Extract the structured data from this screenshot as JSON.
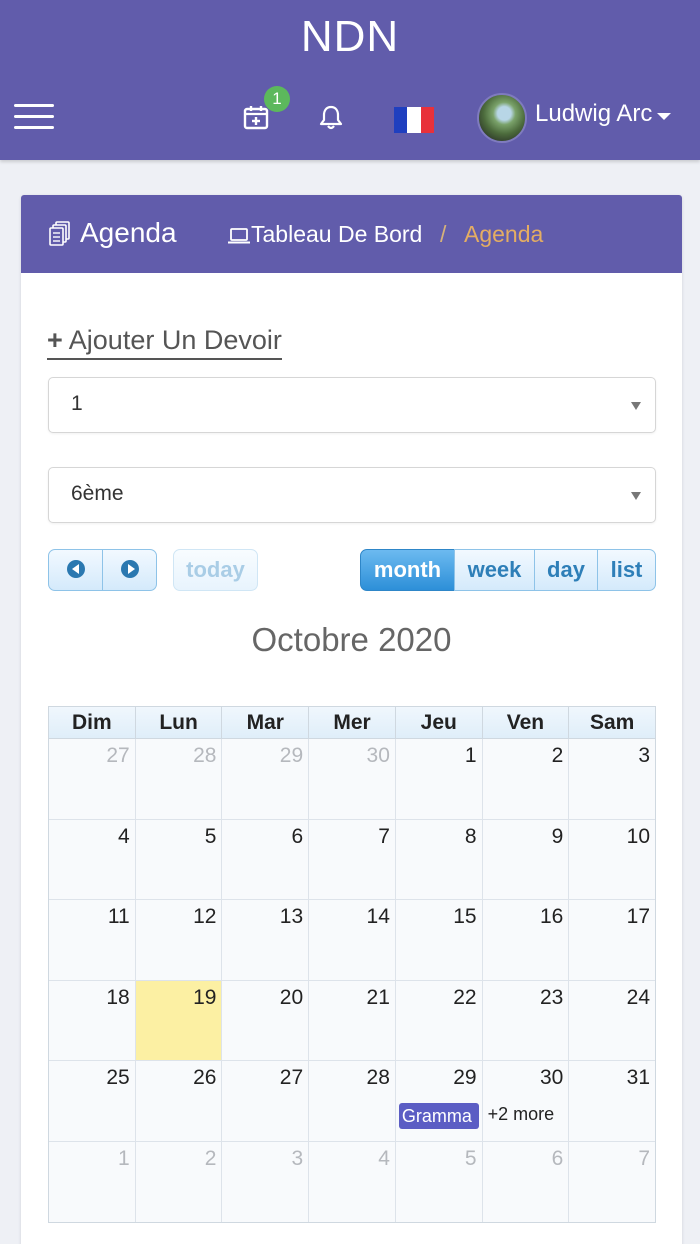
{
  "app": {
    "brand": "NDN"
  },
  "topbar": {
    "notification_count": "1",
    "user_name": "Ludwig Arc",
    "flag_colors": [
      "#1f3fbf",
      "#ffffff",
      "#e8313a"
    ],
    "icons": [
      "menu-icon",
      "calendar-add-icon",
      "bell-icon",
      "french-flag-icon",
      "avatar",
      "caret-down-icon"
    ]
  },
  "page": {
    "title": "Agenda",
    "breadcrumb": {
      "home": "Tableau De Bord",
      "separator": "/",
      "current": "Agenda"
    }
  },
  "form": {
    "add_label": "Ajouter Un Devoir",
    "select1": "1",
    "select2": "6ème"
  },
  "toolbar": {
    "today": "today",
    "month": "month",
    "week": "week",
    "day": "day",
    "list": "list",
    "active_view": "month"
  },
  "calendar": {
    "title": "Octobre 2020",
    "weekdays": [
      "Dim",
      "Lun",
      "Mar",
      "Mer",
      "Jeu",
      "Ven",
      "Sam"
    ],
    "weeks": [
      [
        {
          "d": "27",
          "o": true
        },
        {
          "d": "28",
          "o": true
        },
        {
          "d": "29",
          "o": true
        },
        {
          "d": "30",
          "o": true
        },
        {
          "d": "1"
        },
        {
          "d": "2"
        },
        {
          "d": "3"
        }
      ],
      [
        {
          "d": "4"
        },
        {
          "d": "5"
        },
        {
          "d": "6"
        },
        {
          "d": "7"
        },
        {
          "d": "8"
        },
        {
          "d": "9"
        },
        {
          "d": "10"
        }
      ],
      [
        {
          "d": "11"
        },
        {
          "d": "12"
        },
        {
          "d": "13"
        },
        {
          "d": "14"
        },
        {
          "d": "15"
        },
        {
          "d": "16"
        },
        {
          "d": "17"
        }
      ],
      [
        {
          "d": "18"
        },
        {
          "d": "19",
          "today": true
        },
        {
          "d": "20"
        },
        {
          "d": "21"
        },
        {
          "d": "22"
        },
        {
          "d": "23"
        },
        {
          "d": "24"
        }
      ],
      [
        {
          "d": "25"
        },
        {
          "d": "26"
        },
        {
          "d": "27"
        },
        {
          "d": "28"
        },
        {
          "d": "29",
          "event": "Gramma"
        },
        {
          "d": "30",
          "more": "+2 more"
        },
        {
          "d": "31"
        }
      ],
      [
        {
          "d": "1",
          "o": true
        },
        {
          "d": "2",
          "o": true
        },
        {
          "d": "3",
          "o": true
        },
        {
          "d": "4",
          "o": true
        },
        {
          "d": "5",
          "o": true
        },
        {
          "d": "6",
          "o": true
        },
        {
          "d": "7",
          "o": true
        }
      ]
    ],
    "today_color": "#fcf0a3",
    "event_color": "#5b5dc4"
  }
}
